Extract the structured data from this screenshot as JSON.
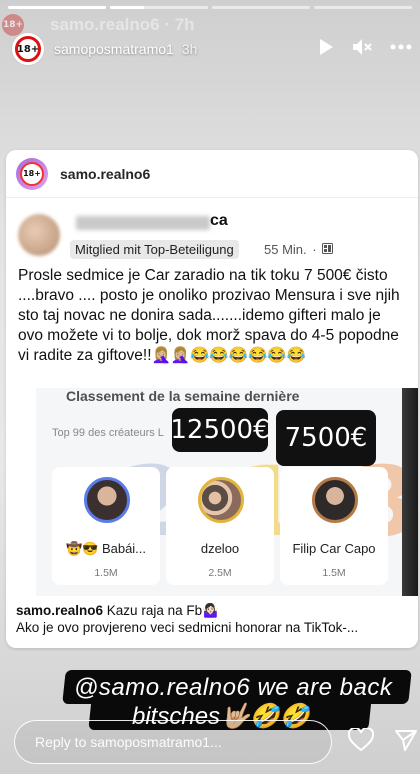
{
  "progress": [
    1,
    0.35,
    0,
    0
  ],
  "ghost": {
    "avatar_text": "18+",
    "name": "samo.realno6 · 7h"
  },
  "header": {
    "avatar_text": "18+",
    "username": "samoposmatramo1",
    "time": "3h"
  },
  "card": {
    "avatar_text": "18+",
    "username": "samo.realno6"
  },
  "fb_post": {
    "name_tail": "ca",
    "badge": "Mitglied mit Top-Beteiligung",
    "time": "55 Min.",
    "dot": "·",
    "text": "Prosle sedmice je Car zaradio na tik toku 7 500€ čisto ....bravo .... posto je onoliko prozivao Mensura i sve njih sto taj novac ne donira sada.......idemo gifteri malo je ovo možete vi to bolje, dok morž spava do 4-5 popodne vi radite za giftove!!🤦🏼‍♀️🤦🏼‍♀️😂😂😂😂😂😂"
  },
  "ranking": {
    "title": "Classement de la semaine dernière",
    "subtitle": "Top 99 des créateurs L",
    "price_left": "12500€",
    "price_right": "7500€",
    "places": [
      {
        "number": "2",
        "name": "🤠😎 Babái...",
        "count": "1.5M"
      },
      {
        "number": "1",
        "name": "dzeloo",
        "count": "2.5M"
      },
      {
        "number": "3",
        "name": "Filip Car Capo",
        "count": "1.5M"
      }
    ]
  },
  "caption": {
    "user": "samo.realno6",
    "line1_rest": " Kazu raja na Fb🤷🏻‍♀️",
    "line2": "Ako je ovo provjereno veci sedmicni honorar na TikTok-..."
  },
  "sticker": {
    "line1": "@samo.realno6 we are back",
    "line2": "bitsches🤟🏼🤣🤣"
  },
  "reply": {
    "placeholder": "Reply to samoposmatramo1..."
  }
}
